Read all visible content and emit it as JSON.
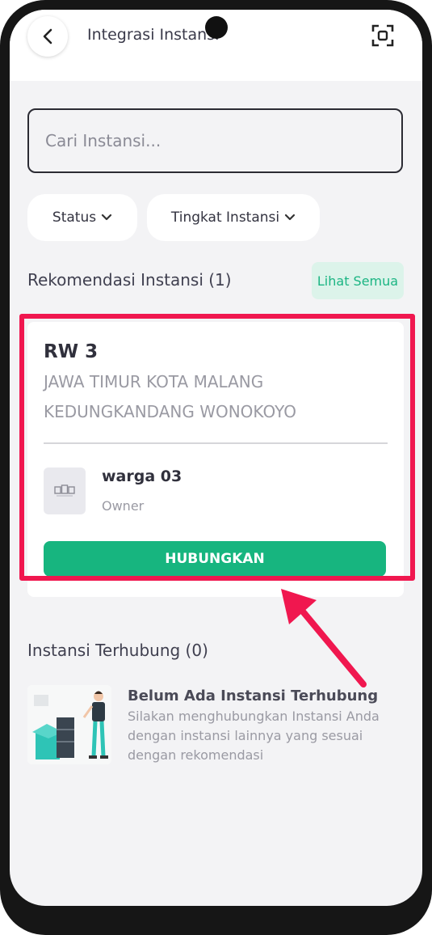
{
  "header": {
    "title": "Integrasi Instansi",
    "back_icon": "chevron-left-icon",
    "scan_icon": "scan-icon"
  },
  "search": {
    "placeholder": "Cari Instansi..."
  },
  "filters": [
    {
      "label": "Status",
      "icon": "chevron-down-icon"
    },
    {
      "label": "Tingkat Instansi",
      "icon": "chevron-down-icon"
    }
  ],
  "recommendation": {
    "title": "Rekomendasi Instansi (1)",
    "see_all": "Lihat Semua",
    "item": {
      "name": "RW 3",
      "address": "JAWA TIMUR KOTA MALANG KEDUNGKANDANG WONOKOYO",
      "owner_name": "warga 03",
      "owner_role": "Owner",
      "button": "HUBUNGKAN"
    }
  },
  "connected": {
    "title": "Instansi Terhubung (0)",
    "empty_title": "Belum Ada Instansi Terhubung",
    "empty_desc": "Silakan menghubungkan Instansi Anda dengan instansi lainnya yang sesuai dengan rekomendasi"
  },
  "colors": {
    "accent": "#17b57f",
    "highlight": "#f0174f",
    "chip_bg": "#ffffff",
    "screen_bg": "#f3f3f5"
  }
}
